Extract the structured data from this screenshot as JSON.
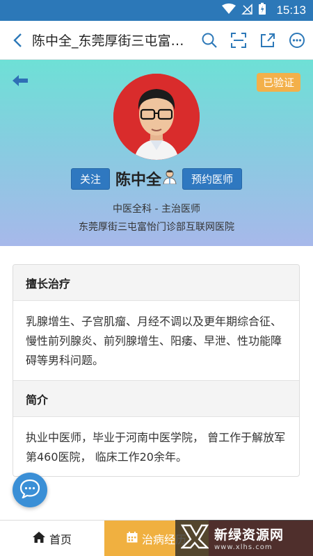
{
  "status_bar": {
    "time": "15:13"
  },
  "browser": {
    "title": "陈中全_东莞厚街三屯富…"
  },
  "header": {
    "verified_badge": "已验证",
    "follow_label": "关注",
    "doctor_name": "陈中全",
    "book_label": "预约医师",
    "department_title": "中医全科 - 主治医师",
    "hospital": "东莞厚街三屯富怡门诊部互联网医院"
  },
  "sections": [
    {
      "heading": "擅长治疗",
      "body": "乳腺增生、子宫肌瘤、月经不调以及更年期综合征、慢性前列腺炎、前列腺增生、阳痿、早泄、性功能障碍等男科问题。"
    },
    {
      "heading": "简介",
      "body": "执业中医师，毕业于河南中医学院， 曾工作于解放军第460医院， 临床工作20余年。"
    }
  ],
  "bottom_nav": {
    "home_label": "首页",
    "history_label": "治病经历",
    "third_label": ""
  },
  "watermark": {
    "title": "新绿资源网",
    "url": "www.xlhs.com"
  },
  "colors": {
    "status_bar": "#2c78b8",
    "accent_blue": "#2f78c0",
    "verified": "#f3b04a",
    "history_tab": "#f0b040",
    "third_tab": "#d94a3d"
  },
  "icons": {
    "browser": [
      "back-chevron-icon",
      "search-icon",
      "scan-icon",
      "share-icon",
      "more-icon"
    ],
    "header": [
      "back-arrow-icon",
      "doctor-icon"
    ],
    "nav": [
      "home-icon",
      "calendar-icon"
    ],
    "fab": "chat-bubble-icon"
  }
}
